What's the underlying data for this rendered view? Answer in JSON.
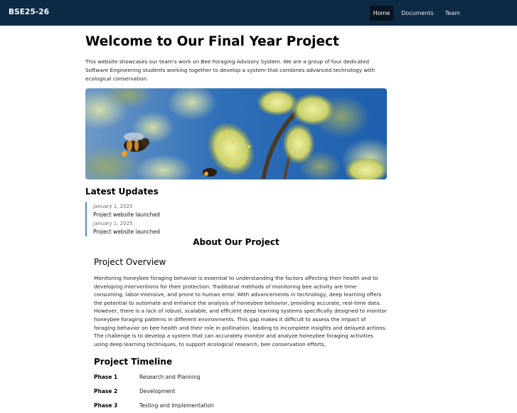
{
  "nav": {
    "brand": "BSE25-26",
    "links": [
      {
        "label": "Home",
        "active": true
      },
      {
        "label": "Documents",
        "active": false
      },
      {
        "label": "Team",
        "active": false
      }
    ]
  },
  "hero": {
    "title": "Welcome to Our Final Year Project",
    "intro": "This website showcases our team's work on Bee Foraging Advisory System. We are a group of four dedicated Software Engineering students working together to develop a system that combines advanced technology with ecological conservation."
  },
  "updates": {
    "title": "Latest Updates",
    "items": [
      {
        "date": "January 1, 2025",
        "text": "Project website launched"
      },
      {
        "date": "January 1, 2025",
        "text": "Project website launched"
      }
    ]
  },
  "about": {
    "title": "About Our Project",
    "overview_title": "Project Overview",
    "overview_text": "Monitoring honeybee foraging behavior is essential to understanding the factors affecting their health and to developing interventions for their protection. Traditional methods of monitoring bee activity are time-consuming, labor-intensive, and prone to human error. With advancements in technology, deep learning offers the potential to automate and enhance the analysis of honeybee behavior, providing accurate, real-time data. However, there is a lack of robust, scalable, and efficient deep learning systems specifically designed to monitor honeybee foraging patterns in different environments. This gap makes it difficult to assess the impact of foraging behavior on bee health and their role in pollination, leading to incomplete insights and delayed actions. The challenge is to develop a system that can accurately monitor and analyze honeybee foraging activities using deep learning techniques, to support ecological research, bee conservation efforts,",
    "timeline_title": "Project Timeline",
    "phases": [
      {
        "name": "Phase 1",
        "desc": "Research and Planning"
      },
      {
        "name": "Phase 2",
        "desc": "Development"
      },
      {
        "name": "Phase 3",
        "desc": "Testing and Implementation"
      }
    ]
  },
  "colors": {
    "navbar": "#0c2a44",
    "active_link": "#081521",
    "accent_border": "#4f8fd8",
    "sky": "#2f6fb8"
  },
  "image": {
    "subject": "honeybee-on-willow-catkins"
  }
}
